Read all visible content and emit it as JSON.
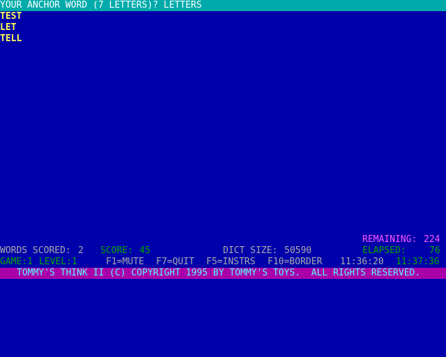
{
  "header": {
    "prompt": "YOUR ANCHOR WORD (7 LETTERS)? LETTERS"
  },
  "words": [
    "TEST",
    "LET",
    "TELL"
  ],
  "status": {
    "remaining_label": "REMAINING:",
    "remaining_value": "224",
    "words_scored_label": "WORDS SCORED:",
    "words_scored_value": "2",
    "score_label": "SCORE:",
    "score_value": "45",
    "dict_size_label": "DICT SIZE:",
    "dict_size_value": "50590",
    "elapsed_label": "ELAPSED:",
    "elapsed_value": "76",
    "game_label": "GAME:1",
    "level_label": "LEVEL:1",
    "f1": "F1=MUTE",
    "f7": "F7=QUIT",
    "f5": "F5=INSTRS",
    "f10": "F10=BORDER",
    "start_time": "11:36:20",
    "current_time": "11:37:36"
  },
  "footer": {
    "copyright": "TOMMY'S THINK II (C) COPYRIGHT 1995 BY TOMMY'S TOYS.  ALL RIGHTS RESERVED."
  },
  "colors": {
    "background": "#0000AA",
    "header_bar": "#00AAAA",
    "words": "#FFFF55",
    "white_status": "#AAAAAA",
    "green_status": "#00AA00",
    "magenta_status": "#FF55FF",
    "footer_bar": "#AA00AA",
    "footer_text": "#55FFFF"
  }
}
